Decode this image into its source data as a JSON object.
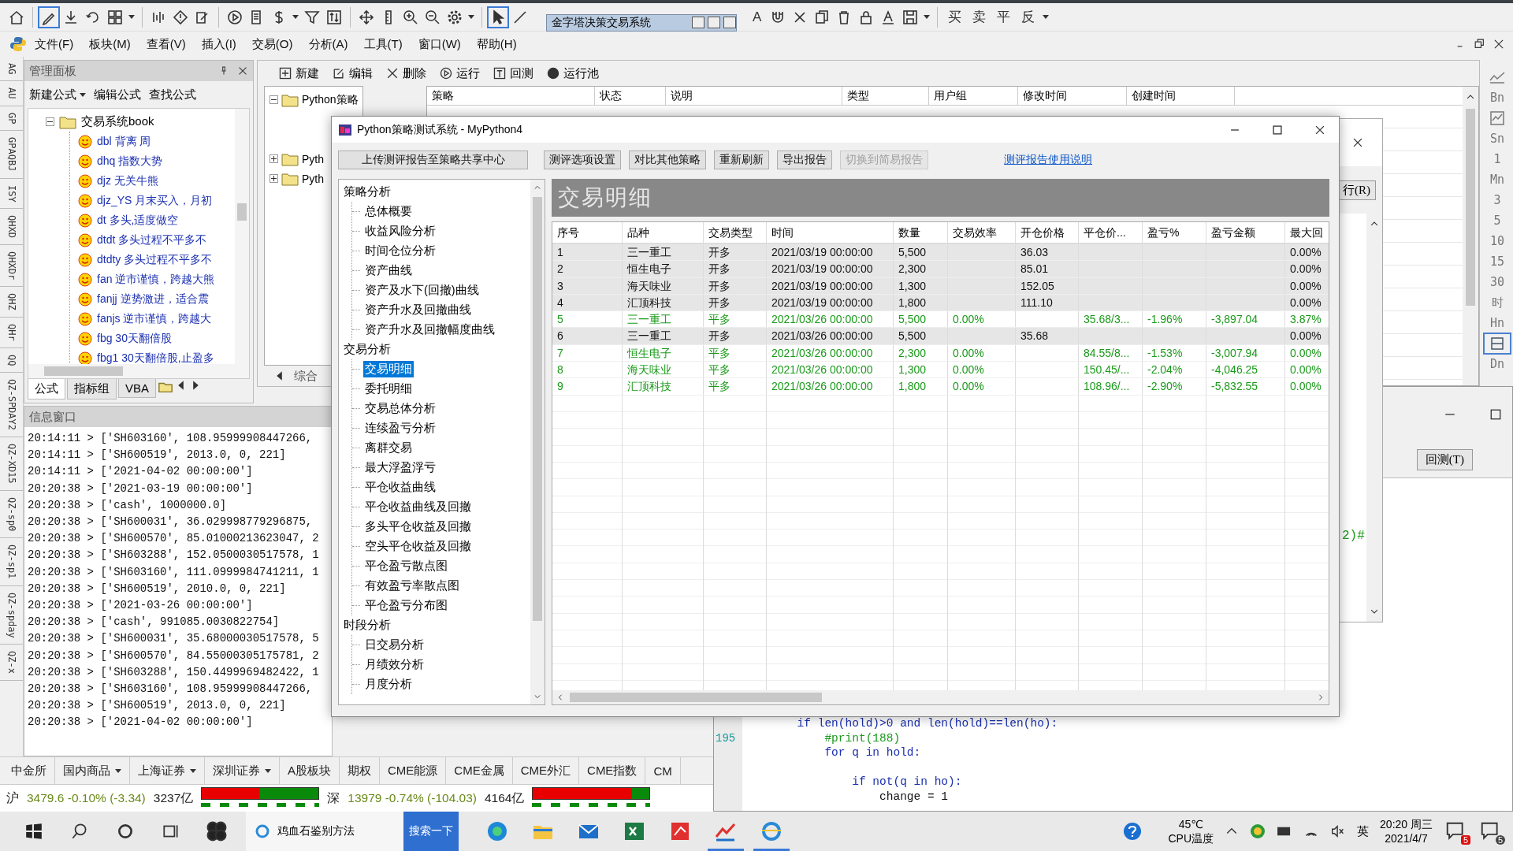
{
  "toolbar": {
    "popup_title": "金字塔决策交易系统",
    "text_tool": "A",
    "trade_buttons": [
      "买",
      "卖",
      "平",
      "反"
    ]
  },
  "menu": {
    "items": [
      "文件(F)",
      "板块(M)",
      "查看(V)",
      "插入(I)",
      "交易(O)",
      "分析(A)",
      "工具(T)",
      "窗口(W)",
      "帮助(H)"
    ]
  },
  "left_strip": {
    "items": [
      "AG",
      "AU",
      "GP",
      "GPAQBJ",
      "ISY",
      "QHXD",
      "QHXDr",
      "QHZ",
      "QHr",
      "QQ",
      "QZ-SPDAY2",
      "QZ-XD15",
      "QZ-sp0",
      "QZ-sp1",
      "QZ-spday",
      "QZ-x"
    ]
  },
  "management_panel": {
    "title": "管理面板",
    "actions": [
      {
        "label": "新建公式",
        "dropdown": true
      },
      {
        "label": "编辑公式",
        "dropdown": false
      },
      {
        "label": "查找公式",
        "dropdown": false
      }
    ],
    "tree": {
      "label": "交易系统book",
      "expanded": true,
      "children": [
        {
          "label": "dbl 背离 周"
        },
        {
          "label": "dhq 指数大势"
        },
        {
          "label": "djz 无关牛熊"
        },
        {
          "label": "djz_YS 月末买入，月初"
        },
        {
          "label": "dt 多头,适度做空"
        },
        {
          "label": "dtdt 多头过程不平多不"
        },
        {
          "label": "dtdty 多头过程不平多不"
        },
        {
          "label": "fan 逆市谨慎，跨越大熊"
        },
        {
          "label": "fanjj 逆势激进，适合震"
        },
        {
          "label": "fanjs 逆市谨慎，跨越大"
        },
        {
          "label": "fbg 30天翻倍股"
        },
        {
          "label": "fbg1 30天翻倍股,止盈多"
        }
      ]
    },
    "tabs": [
      {
        "label": "公式",
        "selected": true
      },
      {
        "label": "指标组",
        "selected": false
      },
      {
        "label": "VBA",
        "selected": false
      }
    ]
  },
  "info_window": {
    "title": "信息窗口",
    "lines": [
      "20:14:11 > ['SH603160', 108.95999908447266,",
      "20:14:11 > ['SH600519', 2013.0, 0, 221]",
      "20:14:11 > ['2021-04-02 00:00:00']",
      "20:20:38 > ['2021-03-19 00:00:00']",
      "20:20:38 > ['cash', 1000000.0]",
      "20:20:38 > ['SH600031', 36.029998779296875,",
      "20:20:38 > ['SH600570', 85.01000213623047, 2",
      "20:20:38 > ['SH603288', 152.0500030517578, 1",
      "20:20:38 > ['SH603160', 111.0999984741211, 1",
      "20:20:38 > ['SH600519', 2010.0, 0, 221]",
      "20:20:38 > ['2021-03-26 00:00:00']",
      "20:20:38 > ['cash', 991085.0030822754]",
      "20:20:38 > ['SH600031', 35.68000030517578, 5",
      "20:20:38 > ['SH600570', 84.55000305175781, 2",
      "20:20:38 > ['SH603288', 150.4499969482422, 1",
      "20:20:38 > ['SH603160', 108.95999908447266,",
      "20:20:38 > ['SH600519', 2013.0, 0, 221]",
      "20:20:38 > ['2021-04-02 00:00:00']"
    ]
  },
  "strategy_window": {
    "actions": [
      "新建",
      "编辑",
      "删除",
      "运行",
      "回测",
      "运行池"
    ],
    "tree": [
      {
        "label": "Python策略",
        "expanded": true
      },
      {
        "label": "Pyth",
        "expanded": false
      },
      {
        "label": "Pyth",
        "expanded": false
      }
    ],
    "columns": [
      "策略",
      "状态",
      "说明",
      "类型",
      "用户组",
      "修改时间",
      "创建时间"
    ],
    "tab": "综合"
  },
  "back_dialog": {
    "button": "行(R)",
    "code_fragment": "2)#"
  },
  "code_window": {
    "button": "回测(T)",
    "lines": [
      {
        "kind": "code",
        "text": "        if len(hold)>0 and len(hold)==len(ho):"
      },
      {
        "number": "195",
        "kind": "comment",
        "text": "            #print(188)"
      },
      {
        "kind": "code",
        "text": "            for q in hold:"
      },
      {
        "kind": "blank"
      },
      {
        "kind": "code",
        "text": "                if not(q in ho):"
      },
      {
        "kind": "plain",
        "text": "                    change = 1"
      }
    ]
  },
  "right_strip": {
    "items": [
      {
        "kind": "line-chart",
        "selected": false
      },
      {
        "kind": "label",
        "label": "Bn",
        "selected": false
      },
      {
        "kind": "area-chart",
        "selected": false
      },
      {
        "kind": "label",
        "label": "Sn",
        "selected": false
      },
      {
        "kind": "label",
        "label": "1",
        "selected": false
      },
      {
        "kind": "label",
        "label": "Mn",
        "selected": false
      },
      {
        "kind": "label",
        "label": "3",
        "selected": false
      },
      {
        "kind": "label",
        "label": "5",
        "selected": false
      },
      {
        "kind": "label",
        "label": "10",
        "selected": false
      },
      {
        "kind": "label",
        "label": "15",
        "selected": false
      },
      {
        "kind": "label",
        "label": "30",
        "selected": false
      },
      {
        "kind": "label",
        "label": "时",
        "selected": false
      },
      {
        "kind": "label",
        "label": "Hn",
        "selected": false
      },
      {
        "kind": "layout",
        "selected": true
      },
      {
        "kind": "label",
        "label": "Dn",
        "selected": false
      }
    ]
  },
  "test_dialog": {
    "title": "Python策略测试系统 - MyPython4",
    "buttons": [
      {
        "label": "上传测评报告至策略共享中心",
        "disabled": false
      },
      {
        "label": "测评选项设置",
        "disabled": false
      },
      {
        "label": "对比其他策略",
        "disabled": false
      },
      {
        "label": "重新刷新",
        "disabled": false
      },
      {
        "label": "导出报告",
        "disabled": false
      },
      {
        "label": "切换到简易报告",
        "disabled": true
      }
    ],
    "help_link": "测评报告使用说明",
    "nav": [
      {
        "label": "策略分析",
        "children": [
          {
            "label": "总体概要",
            "selected": false
          },
          {
            "label": "收益风险分析",
            "selected": false
          },
          {
            "label": "时间仓位分析",
            "selected": false
          },
          {
            "label": "资产曲线",
            "selected": false
          },
          {
            "label": "资产及水下(回撤)曲线",
            "selected": false
          },
          {
            "label": "资产升水及回撤曲线",
            "selected": false
          },
          {
            "label": "资产升水及回撤幅度曲线",
            "selected": false
          }
        ]
      },
      {
        "label": "交易分析",
        "children": [
          {
            "label": "交易明细",
            "selected": true
          },
          {
            "label": "委托明细",
            "selected": false
          },
          {
            "label": "交易总体分析",
            "selected": false
          },
          {
            "label": "连续盈亏分析",
            "selected": false
          },
          {
            "label": "离群交易",
            "selected": false
          },
          {
            "label": "最大浮盈浮亏",
            "selected": false
          },
          {
            "label": "平仓收益曲线",
            "selected": false
          },
          {
            "label": "平仓收益曲线及回撤",
            "selected": false
          },
          {
            "label": "多头平仓收益及回撤",
            "selected": false
          },
          {
            "label": "空头平仓收益及回撤",
            "selected": false
          },
          {
            "label": "平仓盈亏散点图",
            "selected": false
          },
          {
            "label": "有效盈亏率散点图",
            "selected": false
          },
          {
            "label": "平仓盈亏分布图",
            "selected": false
          }
        ]
      },
      {
        "label": "时段分析",
        "children": [
          {
            "label": "日交易分析",
            "selected": false
          },
          {
            "label": "月绩效分析",
            "selected": false
          },
          {
            "label": "月度分析",
            "selected": false
          }
        ]
      }
    ],
    "section_title": "交易明细",
    "table": {
      "columns": [
        "序号",
        "品种",
        "交易类型",
        "时间",
        "数量",
        "交易效率",
        "开仓价格",
        "平仓价...",
        "盈亏%",
        "盈亏金额",
        "最大回"
      ],
      "rows": [
        {
          "kind": "open",
          "cells": [
            "1",
            "三一重工",
            "开多",
            "2021/03/19 00:00:00",
            "5,500",
            null,
            "36.03",
            null,
            null,
            null,
            "0.00%"
          ]
        },
        {
          "kind": "open",
          "cells": [
            "2",
            "恒生电子",
            "开多",
            "2021/03/19 00:00:00",
            "2,300",
            null,
            "85.01",
            null,
            null,
            null,
            "0.00%"
          ]
        },
        {
          "kind": "open",
          "cells": [
            "3",
            "海天味业",
            "开多",
            "2021/03/19 00:00:00",
            "1,300",
            null,
            "152.05",
            null,
            null,
            null,
            "0.00%"
          ]
        },
        {
          "kind": "open",
          "cells": [
            "4",
            "汇顶科技",
            "开多",
            "2021/03/19 00:00:00",
            "1,800",
            null,
            "111.10",
            null,
            null,
            null,
            "0.00%"
          ]
        },
        {
          "kind": "close",
          "cells": [
            "5",
            "三一重工",
            "平多",
            "2021/03/26 00:00:00",
            "5,500",
            "0.00%",
            null,
            "35.68/3...",
            "-1.96%",
            "-3,897.04",
            "3.87%"
          ]
        },
        {
          "kind": "open",
          "cells": [
            "6",
            "三一重工",
            "开多",
            "2021/03/26 00:00:00",
            "5,500",
            null,
            "35.68",
            null,
            null,
            null,
            "0.00%"
          ]
        },
        {
          "kind": "close",
          "cells": [
            "7",
            "恒生电子",
            "平多",
            "2021/03/26 00:00:00",
            "2,300",
            "0.00%",
            null,
            "84.55/8...",
            "-1.53%",
            "-3,007.94",
            "0.00%"
          ]
        },
        {
          "kind": "close",
          "cells": [
            "8",
            "海天味业",
            "平多",
            "2021/03/26 00:00:00",
            "1,300",
            "0.00%",
            null,
            "150.45/...",
            "-2.04%",
            "-4,046.25",
            "0.00%"
          ]
        },
        {
          "kind": "close",
          "cells": [
            "9",
            "汇顶科技",
            "平多",
            "2021/03/26 00:00:00",
            "1,800",
            "0.00%",
            null,
            "108.96/...",
            "-2.90%",
            "-5,832.55",
            "0.00%"
          ]
        }
      ]
    }
  },
  "market": {
    "tabs": [
      {
        "label": "中金所",
        "dropdown": false
      },
      {
        "label": "国内商品",
        "dropdown": true
      },
      {
        "label": "上海证券",
        "dropdown": true
      },
      {
        "label": "深圳证券",
        "dropdown": true
      },
      {
        "label": "A股板块",
        "dropdown": false
      },
      {
        "label": "期权",
        "dropdown": false
      },
      {
        "label": "CME能源",
        "dropdown": false
      },
      {
        "label": "CME金属",
        "dropdown": false
      },
      {
        "label": "CME外汇",
        "dropdown": false
      },
      {
        "label": "CME指数",
        "dropdown": false
      },
      {
        "label": "CM",
        "dropdown": false
      }
    ],
    "indices": [
      {
        "market": "沪",
        "quote": "3479.6 -0.10% (-3.34)",
        "amount": "3237亿",
        "level": 0.5
      },
      {
        "market": "深",
        "quote": "13979 -0.74% (-104.03)",
        "amount": "4164亿",
        "level": 0.85
      }
    ]
  },
  "taskbar": {
    "search_text": "鸡血石鉴别方法",
    "search_button": "搜索一下",
    "apps": [
      {
        "kind": "edge",
        "running": false
      },
      {
        "kind": "folder",
        "running": false
      },
      {
        "kind": "mail",
        "running": false
      },
      {
        "kind": "excel",
        "running": false
      },
      {
        "kind": "red",
        "running": false
      },
      {
        "kind": "chart",
        "running": true
      },
      {
        "kind": "ie",
        "running": true
      }
    ],
    "temperature": "45℃",
    "temperature_label": "CPU温度",
    "ime": "英",
    "time": "20:20 周三",
    "date": "2021/4/7",
    "badges": [
      "5",
      "5"
    ]
  }
}
